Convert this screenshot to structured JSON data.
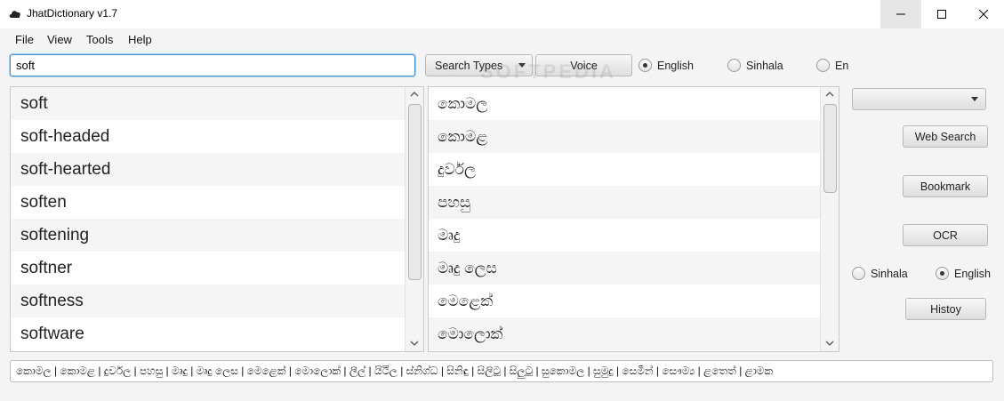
{
  "window": {
    "title": "JhatDictionary v1.7",
    "minimize_glyph": "—",
    "maximize_glyph": "☐",
    "close_glyph": "✕"
  },
  "menu": {
    "items": [
      "File",
      "View",
      "Tools",
      "Help"
    ]
  },
  "search": {
    "value": "soft",
    "search_types_label": "Search Types",
    "voice_label": "Voice",
    "watermark": "SOFTPEDIA"
  },
  "language_top": {
    "options": [
      "English",
      "Sinhala",
      "En"
    ],
    "selected": "English"
  },
  "words": [
    "soft",
    "soft-headed",
    "soft-hearted",
    "soften",
    "softening",
    "softner",
    "softness",
    "software"
  ],
  "translations": [
    "කොමල",
    "කොමළ",
    "දුර්වල",
    "පහසු",
    "මෘදු",
    "මෘදු ලෙස",
    "මෙළෙක්",
    "මොලොක්"
  ],
  "side": {
    "combo_value": "",
    "web_search_label": "Web Search",
    "bookmark_label": "Bookmark",
    "ocr_label": "OCR",
    "history_label": "Histoy",
    "lang_options": [
      "Sinhala",
      "English"
    ],
    "lang_selected": "English"
  },
  "result_line": "කොමල | කොමළ | දුර්වල | පහසු | මෘදු | මෘදු ලෙස | මෙළෙක් | මොලොක් | ලීල් | යිථිල | ස්නිග්ධ | සිනිඳු | සිලිටු | සිලුටු | සුකොමල | සුමුදු | සෙමින් | සෞම්‍ය | ළතෙත් | ළාමක",
  "icons": {
    "app": "cloud-icon",
    "scroll_up": "chevron-up-icon",
    "scroll_down": "chevron-down-icon"
  }
}
